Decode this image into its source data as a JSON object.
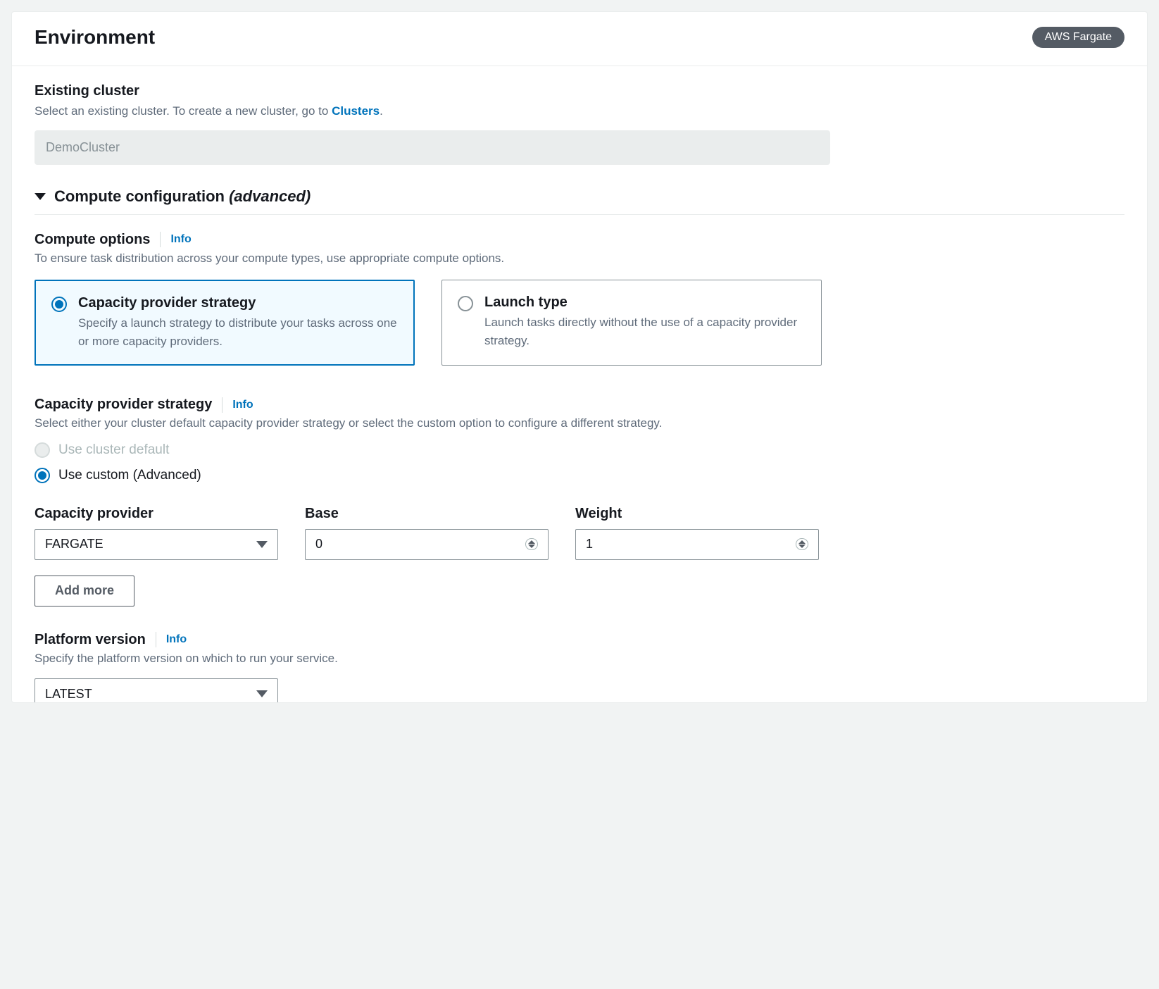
{
  "header": {
    "title": "Environment",
    "badge": "AWS Fargate"
  },
  "cluster": {
    "label": "Existing cluster",
    "desc_prefix": "Select an existing cluster. To create a new cluster, go to ",
    "desc_link": "Clusters",
    "desc_suffix": ".",
    "value": "DemoCluster"
  },
  "compute_config": {
    "expand_title_main": "Compute configuration ",
    "expand_title_em": "(advanced)"
  },
  "compute_options": {
    "label": "Compute options",
    "info": "Info",
    "desc": "To ensure task distribution across your compute types, use appropriate compute options.",
    "tiles": {
      "capacity_provider": {
        "title": "Capacity provider strategy",
        "desc": "Specify a launch strategy to distribute your tasks across one or more capacity providers."
      },
      "launch_type": {
        "title": "Launch type",
        "desc": "Launch tasks directly without the use of a capacity provider strategy."
      }
    }
  },
  "capacity_strategy": {
    "label": "Capacity provider strategy",
    "info": "Info",
    "desc": "Select either your cluster default capacity provider strategy or select the custom option to configure a different strategy.",
    "options": {
      "default": "Use cluster default",
      "custom": "Use custom (Advanced)"
    }
  },
  "provider_fields": {
    "capacity_provider_label": "Capacity provider",
    "capacity_provider_value": "FARGATE",
    "base_label": "Base",
    "base_value": "0",
    "weight_label": "Weight",
    "weight_value": "1",
    "add_more": "Add more"
  },
  "platform_version": {
    "label": "Platform version",
    "info": "Info",
    "desc": "Specify the platform version on which to run your service.",
    "value": "LATEST"
  }
}
